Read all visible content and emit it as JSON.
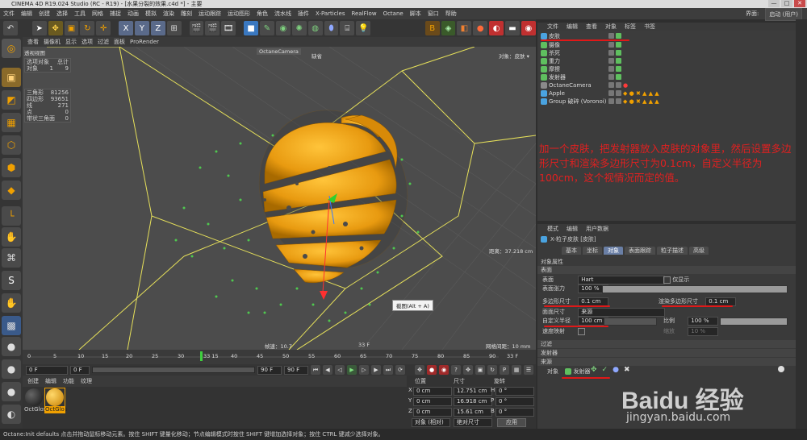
{
  "window": {
    "title": "CINEMA 4D R19.024 Studio (RC - R19) - [水果分裂的效果.c4d *] - 主要",
    "controls": [
      "—",
      "□",
      "✕"
    ]
  },
  "menu": {
    "items": [
      "文件",
      "编辑",
      "创建",
      "选择",
      "工具",
      "网格",
      "捕捉",
      "动画",
      "模拟",
      "渲染",
      "雕刻",
      "运动跟踪",
      "运动图形",
      "角色",
      "流水线",
      "插件",
      "X-Particles",
      "RealFlow",
      "Octane",
      "脚本",
      "窗口",
      "帮助"
    ],
    "layout_label": "界面:",
    "layout_value": "启动 (用户)"
  },
  "viewport": {
    "menu": [
      "查看",
      "摄像机",
      "显示",
      "选项",
      "过滤",
      "面板",
      "ProRender"
    ],
    "label": "透视视图",
    "camera": "OctaneCamera",
    "camera_tag": "缺省",
    "top_right": "对象：皮肤 ▾",
    "distance": "距离：37.218 cm",
    "speed": "帧速：10.7",
    "frame": "33 F",
    "grid": "网格间距：10 mm",
    "tooltip": "截图(Alt + A)",
    "stats": {
      "header": [
        "选项对象",
        "总计"
      ],
      "objects_label": "对象",
      "objects_sel": "1",
      "objects_total": "9",
      "rows": [
        {
          "k": "三角形",
          "v": "81256"
        },
        {
          "k": "四边形",
          "v": "93651"
        },
        {
          "k": "线",
          "v": "271"
        },
        {
          "k": "点",
          "v": "0"
        },
        {
          "k": "带状三角面",
          "v": "0"
        }
      ]
    }
  },
  "timeline": {
    "ticks": [
      "0",
      "5",
      "10",
      "15",
      "20",
      "25",
      "30",
      "33 15",
      "40",
      "45",
      "50",
      "55",
      "60",
      "65",
      "70",
      "75",
      "80",
      "85",
      "90"
    ],
    "end": "33 F",
    "current": 33
  },
  "playbar": {
    "start": "0 F",
    "start2": "0 F",
    "end": "90 F",
    "end2": "90 F"
  },
  "materials": {
    "menu": [
      "创建",
      "编辑",
      "功能",
      "纹理"
    ],
    "items": [
      {
        "name": "OctGlos",
        "color": "#1a1a1a"
      },
      {
        "name": "OctGlos",
        "color": "#f0a800"
      }
    ]
  },
  "coords": {
    "headers": [
      "位置",
      "尺寸",
      "旋转"
    ],
    "rows": [
      {
        "axis": "X",
        "pos": "0 cm",
        "size": "12.751 cm",
        "rotL": "H",
        "rot": "0 °"
      },
      {
        "axis": "Y",
        "pos": "0 cm",
        "size": "16.918 cm",
        "rotL": "P",
        "rot": "0 °"
      },
      {
        "axis": "Z",
        "pos": "0 cm",
        "size": "15.61 cm",
        "rotL": "B",
        "rot": "0 °"
      }
    ],
    "mode": "对象 (相对)",
    "size_mode": "绝对尺寸",
    "apply": "应用"
  },
  "object_manager": {
    "menu": [
      "文件",
      "编辑",
      "查看",
      "对象",
      "标签",
      "书签"
    ],
    "objects": [
      {
        "name": "皮肤",
        "color": "#4aa3e0",
        "tags": ""
      },
      {
        "name": "摄像",
        "color": "#5fbf5f",
        "tags": ""
      },
      {
        "name": "杀死",
        "color": "#5fbf5f",
        "tags": ""
      },
      {
        "name": "重力",
        "color": "#5fbf5f",
        "tags": ""
      },
      {
        "name": "摩擦",
        "color": "#5fbf5f",
        "tags": ""
      },
      {
        "name": "发射器",
        "color": "#5fbf5f",
        "tags": ""
      },
      {
        "name": "OctaneCamera",
        "color": "#8a8a8a",
        "tags": "●"
      },
      {
        "name": "Apple",
        "color": "#4aa3e0",
        "tags": "◆ ● ✖ ▲ ▲ ▲"
      },
      {
        "name": "Group 破碎 (Voronoi) .1",
        "color": "#4aa3e0",
        "tags": "◆ ● ✖ ▲ ▲ ▲"
      }
    ]
  },
  "annotation": "加一个皮肤，把发射器放入皮肤的对象里，然后设置多边形尺寸和渲染多边形尺寸为0.1cm，自定义半径为100cm，这个视情况而定的值。",
  "attributes": {
    "menu": [
      "模式",
      "编辑",
      "用户数据"
    ],
    "object_title": "X-粒子皮肤 [皮肤]",
    "tabs": [
      "基本",
      "坐标",
      "对象",
      "表面跟踪",
      "粒子描述",
      "高级"
    ],
    "section": "对象属性",
    "subsection": "表面",
    "props": {
      "surface_label": "表面",
      "surface_value": "Hart",
      "surface_tension_label": "表面张力",
      "surface_tension_value": "100 %",
      "only_visible_label": "仅显示",
      "poly_size_label": "多边形尺寸",
      "poly_size_value": "0.1 cm",
      "render_poly_label": "渲染多边形尺寸",
      "render_poly_value": "0.1 cm",
      "face_size_label": "面面尺寸",
      "face_size_value": "来源",
      "custom_radius_label": "自定义半径",
      "custom_radius_value": "100 cm",
      "ratio_label": "比例",
      "ratio_value": "100 %",
      "speed_map_label": "速度映射",
      "scale_label": "缩放",
      "scale_value": "10 %"
    },
    "collapsed": [
      "过滤",
      "发射器",
      "来源"
    ],
    "emitter_row_label": "对象",
    "emitter_value": "发射器"
  },
  "statusbar": "Octane:Init defaults   点击并拖动鼠标移动元素。按住 SHIFT 键量化移动；节点编辑模式时按住 SHIFT 键增加选择对象；按住 CTRL 键减少选择对象。",
  "watermark": {
    "text": "Baidu 经验",
    "url": "jingyan.baidu.com"
  }
}
